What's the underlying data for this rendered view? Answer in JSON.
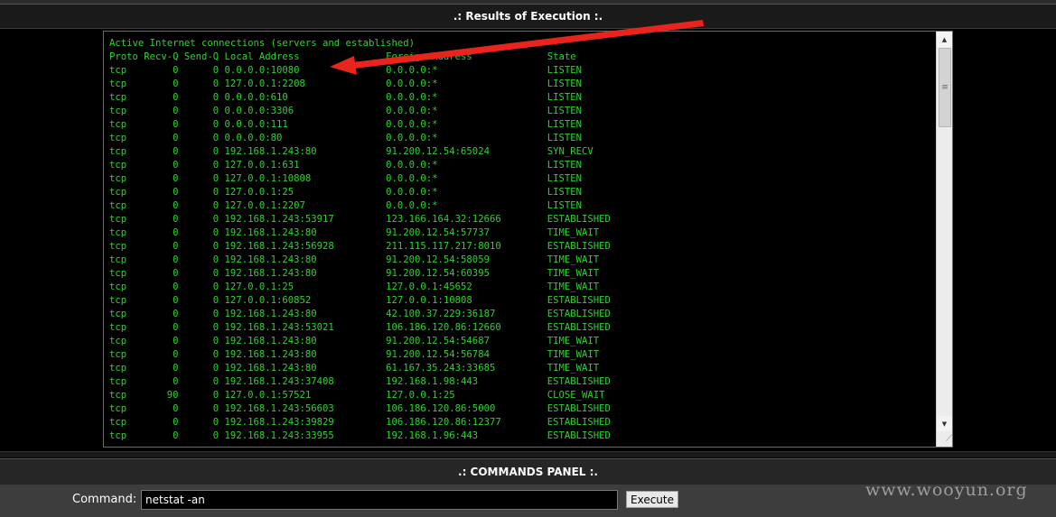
{
  "results": {
    "title": ".: Results of Execution :.",
    "output": "Active Internet connections (servers and established)\nProto Recv-Q Send-Q Local Address               Foreign Address             State\ntcp        0      0 0.0.0.0:10080               0.0.0.0:*                   LISTEN\ntcp        0      0 127.0.0.1:2208              0.0.0.0:*                   LISTEN\ntcp        0      0 0.0.0.0:610                 0.0.0.0:*                   LISTEN\ntcp        0      0 0.0.0.0:3306                0.0.0.0:*                   LISTEN\ntcp        0      0 0.0.0.0:111                 0.0.0.0:*                   LISTEN\ntcp        0      0 0.0.0.0:80                  0.0.0.0:*                   LISTEN\ntcp        0      0 192.168.1.243:80            91.200.12.54:65024          SYN_RECV\ntcp        0      0 127.0.0.1:631               0.0.0.0:*                   LISTEN\ntcp        0      0 127.0.0.1:10808             0.0.0.0:*                   LISTEN\ntcp        0      0 127.0.0.1:25                0.0.0.0:*                   LISTEN\ntcp        0      0 127.0.0.1:2207              0.0.0.0:*                   LISTEN\ntcp        0      0 192.168.1.243:53917         123.166.164.32:12666        ESTABLISHED\ntcp        0      0 192.168.1.243:80            91.200.12.54:57737          TIME_WAIT\ntcp        0      0 192.168.1.243:56928         211.115.117.217:8010        ESTABLISHED\ntcp        0      0 192.168.1.243:80            91.200.12.54:58059          TIME_WAIT\ntcp        0      0 192.168.1.243:80            91.200.12.54:60395          TIME_WAIT\ntcp        0      0 127.0.0.1:25                127.0.0.1:45652             TIME_WAIT\ntcp        0      0 127.0.0.1:60852             127.0.0.1:10808             ESTABLISHED\ntcp        0      0 192.168.1.243:80            42.100.37.229:36187         ESTABLISHED\ntcp        0      0 192.168.1.243:53021         106.186.120.86:12660        ESTABLISHED\ntcp        0      0 192.168.1.243:80            91.200.12.54:54687          TIME_WAIT\ntcp        0      0 192.168.1.243:80            91.200.12.54:56784          TIME_WAIT\ntcp        0      0 192.168.1.243:80            61.167.35.243:33685         TIME_WAIT\ntcp        0      0 192.168.1.243:37408         192.168.1.98:443            ESTABLISHED\ntcp       90      0 127.0.0.1:57521             127.0.0.1:25                CLOSE_WAIT\ntcp        0      0 192.168.1.243:56603         106.186.120.86:5000         ESTABLISHED\ntcp        0      0 192.168.1.243:39829         106.186.120.86:12377        ESTABLISHED\ntcp        0      0 192.168.1.243:33955         192.168.1.96:443            ESTABLISHED",
    "text_color": "#2bd42b"
  },
  "commands": {
    "title": ".: COMMANDS PANEL :.",
    "label": "Command:",
    "value": "netstat -an",
    "execute_label": "Execute"
  },
  "icons": {
    "scroll_up": "scroll-up-arrow-icon",
    "scroll_down": "scroll-down-arrow-icon",
    "scroll_grip": "scroll-grip-icon",
    "resize": "resize-grip-icon",
    "annotation": "red-arrow-annotation"
  },
  "annotation_color": "#e8241c",
  "watermark": "www.wooyun.org"
}
